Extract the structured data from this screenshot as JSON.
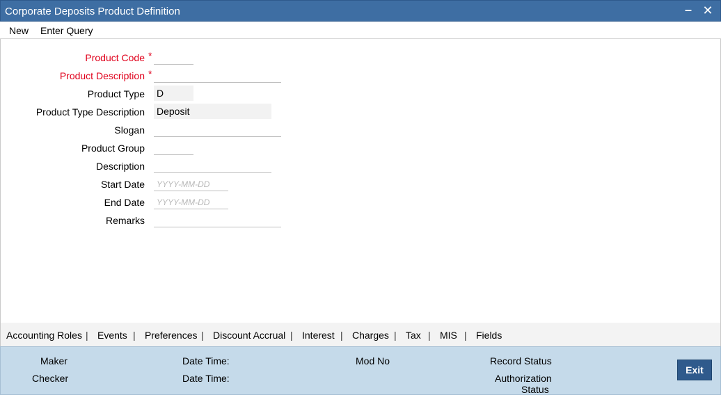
{
  "window": {
    "title": "Corporate Deposits Product Definition"
  },
  "menu": {
    "new": "New",
    "enter_query": "Enter Query"
  },
  "form": {
    "product_code_label": "Product Code",
    "product_description_label": "Product Description",
    "product_type_label": "Product Type",
    "product_type_value": "D",
    "product_type_description_label": "Product Type Description",
    "product_type_description_value": "Deposit",
    "slogan_label": "Slogan",
    "product_group_label": "Product Group",
    "description_label": "Description",
    "start_date_label": "Start Date",
    "start_date_placeholder": "YYYY-MM-DD",
    "end_date_label": "End Date",
    "end_date_placeholder": "YYYY-MM-DD",
    "remarks_label": "Remarks",
    "required_marker": "*"
  },
  "tabs": {
    "items": [
      "Accounting Roles",
      "Events",
      "Preferences",
      "Discount Accrual",
      "Interest",
      "Charges",
      "Tax",
      "MIS",
      "Fields"
    ],
    "separator": "|"
  },
  "footer": {
    "maker": "Maker",
    "checker": "Checker",
    "date_time_1": "Date Time:",
    "date_time_2": "Date Time:",
    "mod_no": "Mod No",
    "record_status": "Record Status",
    "authorization_status_line1": "Authorization",
    "authorization_status_line2": "Status",
    "exit": "Exit"
  }
}
